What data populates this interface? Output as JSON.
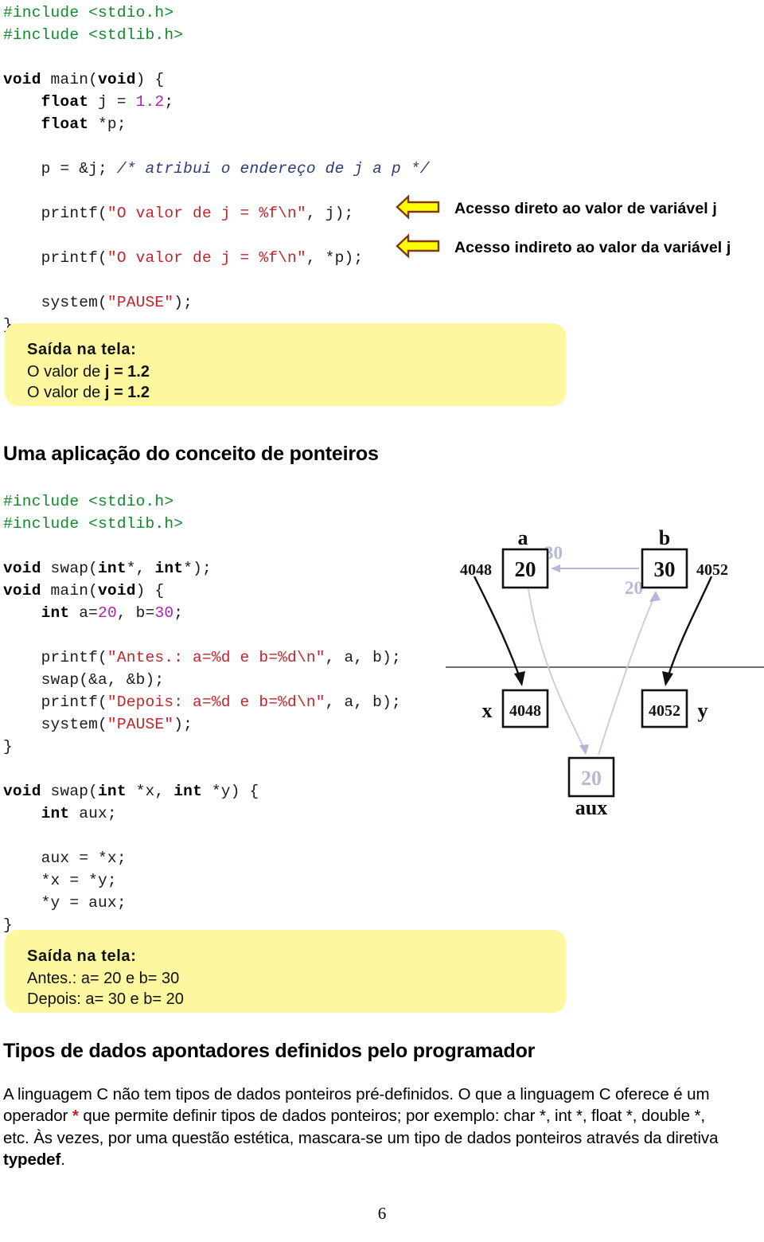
{
  "page": {
    "number": "6",
    "background": "#ffffff"
  },
  "colors": {
    "preprocessor": "#128a2a",
    "string": "#c0262b",
    "number_literal": "#b01fb0",
    "comment": "#2b3a7a",
    "callout_fill": "#ffff00",
    "callout_stroke": "#7a3b10",
    "output_box_fill": "#fdf8a0",
    "diagram_accent": "#b3b8d8",
    "red_star": "#d01f1f"
  },
  "code_block_1": {
    "name": "pointer-basics-example",
    "lines": [
      [
        {
          "t": "#include <stdio.h>",
          "c": "pp"
        }
      ],
      [
        {
          "t": "#include <stdlib.h>",
          "c": "pp"
        }
      ],
      [],
      [
        {
          "t": "void",
          "c": "kw"
        },
        {
          "t": " main(",
          "c": ""
        },
        {
          "t": "void",
          "c": "kw"
        },
        {
          "t": ") {",
          "c": ""
        }
      ],
      [
        {
          "t": "    ",
          "c": ""
        },
        {
          "t": "float",
          "c": "kw"
        },
        {
          "t": " j = ",
          "c": ""
        },
        {
          "t": "1.2",
          "c": "num"
        },
        {
          "t": ";",
          "c": ""
        }
      ],
      [
        {
          "t": "    ",
          "c": ""
        },
        {
          "t": "float",
          "c": "kw"
        },
        {
          "t": " *p;",
          "c": ""
        }
      ],
      [],
      [
        {
          "t": "    p = &j; ",
          "c": ""
        },
        {
          "t": "/* atribui o endereço de j a p */",
          "c": "cmt"
        }
      ],
      [],
      [
        {
          "t": "    printf(",
          "c": ""
        },
        {
          "t": "\"O valor de j = %f\\n\"",
          "c": "str"
        },
        {
          "t": ", j);",
          "c": ""
        }
      ],
      [],
      [
        {
          "t": "    printf(",
          "c": ""
        },
        {
          "t": "\"O valor de j = %f\\n\"",
          "c": "str"
        },
        {
          "t": ", *p);",
          "c": ""
        }
      ],
      [],
      [
        {
          "t": "    system(",
          "c": ""
        },
        {
          "t": "\"PAUSE\"",
          "c": "str"
        },
        {
          "t": ");",
          "c": ""
        }
      ],
      [
        {
          "t": "}",
          "c": ""
        }
      ]
    ]
  },
  "callouts": [
    {
      "id": "arrow-note-1",
      "icon": "left-arrow-icon",
      "text": "Acesso direto ao valor de variável j"
    },
    {
      "id": "arrow-note-2",
      "icon": "left-arrow-icon",
      "text": "Acesso indireto ao valor da variável j"
    }
  ],
  "output_box_1": {
    "title": "Saída na tela:",
    "lines": [
      "O valor de j = 1.2",
      "O valor de j = 1.2"
    ]
  },
  "heading_ponteiros": "Uma aplicação do conceito de ponteiros",
  "code_block_2": {
    "name": "swap-function-example",
    "lines": [
      [
        {
          "t": "#include <stdio.h>",
          "c": "pp"
        }
      ],
      [
        {
          "t": "#include <stdlib.h>",
          "c": "pp"
        }
      ],
      [],
      [
        {
          "t": "void",
          "c": "kw"
        },
        {
          "t": " swap(",
          "c": ""
        },
        {
          "t": "int",
          "c": "kw"
        },
        {
          "t": "*, ",
          "c": ""
        },
        {
          "t": "int",
          "c": "kw"
        },
        {
          "t": "*);",
          "c": ""
        }
      ],
      [
        {
          "t": "void",
          "c": "kw"
        },
        {
          "t": " main(",
          "c": ""
        },
        {
          "t": "void",
          "c": "kw"
        },
        {
          "t": ") {",
          "c": ""
        }
      ],
      [
        {
          "t": "    ",
          "c": ""
        },
        {
          "t": "int",
          "c": "kw"
        },
        {
          "t": " a=",
          "c": ""
        },
        {
          "t": "20",
          "c": "num"
        },
        {
          "t": ", b=",
          "c": ""
        },
        {
          "t": "30",
          "c": "num"
        },
        {
          "t": ";",
          "c": ""
        }
      ],
      [],
      [
        {
          "t": "    printf(",
          "c": ""
        },
        {
          "t": "\"Antes.: a=%d e b=%d\\n\"",
          "c": "str"
        },
        {
          "t": ", a, b);",
          "c": ""
        }
      ],
      [
        {
          "t": "    swap(&a, &b);",
          "c": ""
        }
      ],
      [
        {
          "t": "    printf(",
          "c": ""
        },
        {
          "t": "\"Depois: a=%d e b=%d\\n\"",
          "c": "str"
        },
        {
          "t": ", a, b);",
          "c": ""
        }
      ],
      [
        {
          "t": "    system(",
          "c": ""
        },
        {
          "t": "\"PAUSE\"",
          "c": "str"
        },
        {
          "t": ");",
          "c": ""
        }
      ],
      [
        {
          "t": "}",
          "c": ""
        }
      ],
      [],
      [
        {
          "t": "void",
          "c": "kw"
        },
        {
          "t": " swap(",
          "c": ""
        },
        {
          "t": "int",
          "c": "kw"
        },
        {
          "t": " *x, ",
          "c": ""
        },
        {
          "t": "int",
          "c": "kw"
        },
        {
          "t": " *y) {",
          "c": ""
        }
      ],
      [
        {
          "t": "    ",
          "c": ""
        },
        {
          "t": "int",
          "c": "kw"
        },
        {
          "t": " aux;",
          "c": ""
        }
      ],
      [],
      [
        {
          "t": "    aux = *x;",
          "c": ""
        }
      ],
      [
        {
          "t": "    *x = *y;",
          "c": ""
        }
      ],
      [
        {
          "t": "    *y = aux;",
          "c": ""
        }
      ],
      [
        {
          "t": "}",
          "c": ""
        }
      ]
    ]
  },
  "memory_diagram": {
    "name": "swap-memory-diagram",
    "boxes": [
      {
        "id": "box-a",
        "label": "a",
        "label_pos": "top",
        "value": "20"
      },
      {
        "id": "box-b",
        "label": "b",
        "label_pos": "top",
        "value": "30"
      },
      {
        "id": "box-x",
        "label": "x",
        "label_pos": "left",
        "value": "4048"
      },
      {
        "id": "box-y",
        "label": "y",
        "label_pos": "right",
        "value": "4052"
      },
      {
        "id": "box-aux",
        "label": "aux",
        "label_pos": "bottom",
        "value": "20"
      }
    ],
    "address_labels": [
      "4048",
      "4052"
    ],
    "ghost_values": [
      "30",
      "20",
      "20"
    ],
    "divider": true
  },
  "output_box_2": {
    "title": "Saída na tela:",
    "lines": [
      "Antes.: a= 20 e b= 30",
      "Depois: a= 30 e b= 20"
    ]
  },
  "heading_tipos": "Tipos de dados apontadores definidos pelo programador",
  "paragraph": {
    "part1": "A linguagem C não tem tipos de dados ponteiros pré-definidos. O que a linguagem C oferece é um operador ",
    "star": "*",
    "part2": " que permite definir tipos de dados ponteiros; por exemplo: char *, int *, float *, double *, etc. Às vezes, por uma questão estética, mascara-se um tipo de dados ponteiros através da diretiva ",
    "keyword": "typedef",
    "part3": "."
  }
}
